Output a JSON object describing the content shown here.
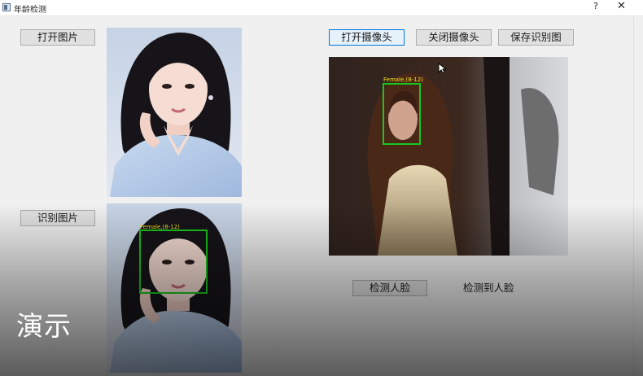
{
  "window": {
    "title": "年龄检测",
    "help_label": "?",
    "close_label": "✕"
  },
  "buttons": {
    "open_image": "打开图片",
    "recognize_image": "识别图片",
    "open_camera": "打开摄像头",
    "close_camera": "关闭摄像头",
    "save_image": "保存识别图",
    "detect_face": "检测人脸"
  },
  "status": {
    "face_detected": "检测到人脸"
  },
  "detections": {
    "result_label": "Female,(8-12)",
    "camera_label": "Female,(8-12)"
  },
  "overlay": {
    "watermark": "演示"
  },
  "colors": {
    "box": "#18c61e",
    "label": "#f3e21a",
    "focus_border": "#0078d7"
  }
}
